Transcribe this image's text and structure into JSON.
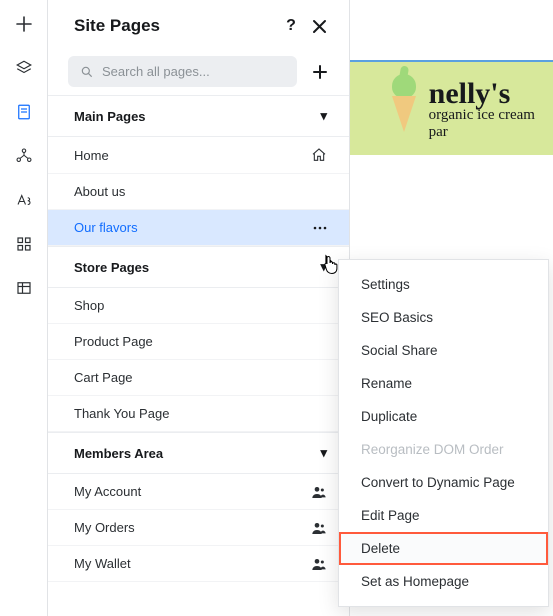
{
  "panel": {
    "title": "Site Pages",
    "search_placeholder": "Search all pages..."
  },
  "sections": {
    "main": {
      "title": "Main Pages"
    },
    "store": {
      "title": "Store Pages"
    },
    "members": {
      "title": "Members Area"
    }
  },
  "pages": {
    "main": [
      {
        "name": "Home",
        "icon": "home"
      },
      {
        "name": "About us",
        "icon": null
      },
      {
        "name": "Our flavors",
        "icon": "more",
        "selected": true
      }
    ],
    "store": [
      {
        "name": "Shop"
      },
      {
        "name": "Product Page"
      },
      {
        "name": "Cart Page"
      },
      {
        "name": "Thank You Page"
      }
    ],
    "members": [
      {
        "name": "My Account",
        "icon": "members"
      },
      {
        "name": "My Orders",
        "icon": "members"
      },
      {
        "name": "My Wallet",
        "icon": "members"
      }
    ]
  },
  "context_menu": {
    "items": [
      {
        "label": "Settings"
      },
      {
        "label": "SEO Basics"
      },
      {
        "label": "Social Share"
      },
      {
        "label": "Rename"
      },
      {
        "label": "Duplicate"
      },
      {
        "label": "Reorganize DOM Order",
        "disabled": true
      },
      {
        "label": "Convert to Dynamic Page"
      },
      {
        "label": "Edit Page"
      },
      {
        "label": "Delete",
        "highlighted": true
      },
      {
        "label": "Set as Homepage"
      }
    ]
  },
  "brand": {
    "title": "nelly's",
    "subtitle": "organic ice cream par"
  }
}
